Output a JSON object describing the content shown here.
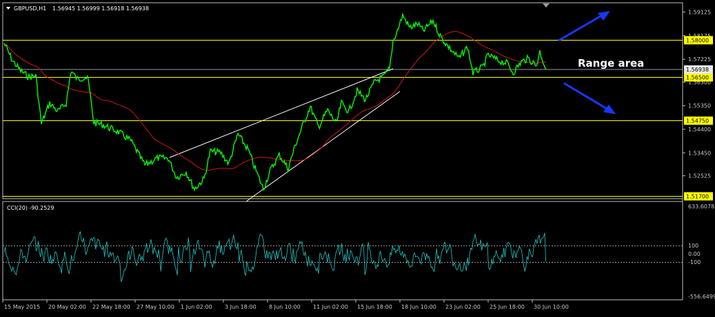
{
  "header": {
    "symbol": "GBPUSD,H1",
    "ohlc": "1.56945 1.56999 1.56918 1.56938",
    "indicator": "CCI(20) -90.2529"
  },
  "annotation": {
    "text": "Range area"
  },
  "colors": {
    "background": "#000000",
    "price": "#00ff00",
    "ma": "#d01818",
    "cci": "#1fb7b7",
    "level": "#ffff00",
    "trendline": "#ffffff",
    "arrow": "#1638ff",
    "grid": "#c0c0c0",
    "current_price_line": "#9a9aa8"
  },
  "price_axis": {
    "ticks": [
      "1.59125",
      "1.58175",
      "1.57225",
      "1.56300",
      "1.55350",
      "1.54400",
      "1.53450",
      "1.52525"
    ],
    "levels": [
      "1.58000",
      "1.56500",
      "1.54750",
      "1.51700"
    ],
    "current": "1.56938"
  },
  "indicator_axis": {
    "ticks": [
      "633.6078",
      "100",
      "0.00",
      "-100",
      "-556.6499"
    ]
  },
  "time_axis": {
    "labels": [
      "15 May 2015",
      "20 May 02:00",
      "22 May 18:00",
      "27 May 10:00",
      "1 Jun 02:00",
      "3 Jun 18:00",
      "8 Jun 10:00",
      "11 Jun 02:00",
      "15 Jun 18:00",
      "18 Jun 10:00",
      "23 Jun 02:00",
      "25 Jun 18:00",
      "30 Jun 10:00"
    ]
  },
  "chart_data": {
    "type": "line",
    "title": "GBPUSD,H1",
    "x": [
      "15 May 2015",
      "20 May 02:00",
      "22 May 18:00",
      "27 May 10:00",
      "1 Jun 02:00",
      "3 Jun 18:00",
      "8 Jun 10:00",
      "11 Jun 02:00",
      "15 Jun 18:00",
      "18 Jun 10:00",
      "23 Jun 02:00",
      "25 Jun 18:00",
      "30 Jun 10:00"
    ],
    "series": [
      {
        "values": [
          1.5775,
          1.5655,
          1.559,
          1.5375,
          1.519,
          1.534,
          1.529,
          1.553,
          1.562,
          1.5905,
          1.574,
          1.5705,
          1.5695
        ]
      }
    ],
    "levels": [
      1.58,
      1.565,
      1.5475,
      1.517
    ],
    "ylim": [
      1.516,
      1.595
    ],
    "cci": {
      "name": "CCI(20)",
      "last": -90.2529,
      "levels": [
        100,
        0,
        -100
      ],
      "ylim": [
        -556.6499,
        633.6078
      ]
    },
    "grid": false
  }
}
